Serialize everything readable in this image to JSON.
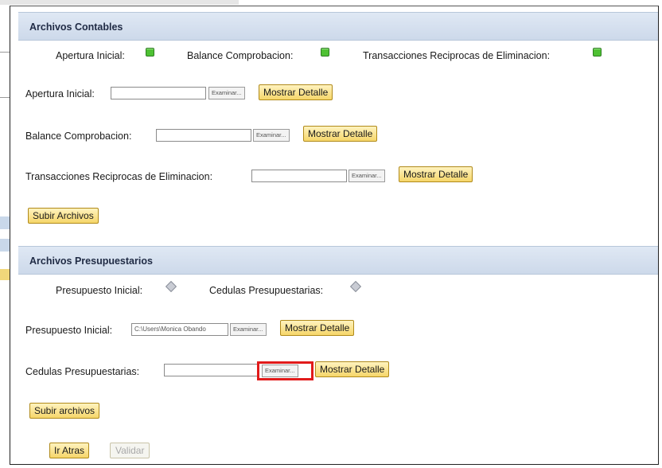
{
  "contables": {
    "title": "Archivos Contables",
    "status": [
      {
        "label": "Apertura Inicial:",
        "state": "green"
      },
      {
        "label": "Balance Comprobacion:",
        "state": "green"
      },
      {
        "label": "Transacciones Reciprocas de Eliminacion:",
        "state": "green"
      }
    ],
    "rows": [
      {
        "label": "Apertura Inicial:",
        "value": "",
        "browse": "Examinar...",
        "detail": "Mostrar Detalle"
      },
      {
        "label": "Balance Comprobacion:",
        "value": "",
        "browse": "Examinar...",
        "detail": "Mostrar Detalle"
      },
      {
        "label": "Transacciones Reciprocas de Eliminacion:",
        "value": "",
        "browse": "Examinar...",
        "detail": "Mostrar Detalle"
      }
    ],
    "upload_label": "Subir Archivos"
  },
  "presupuestarios": {
    "title": "Archivos Presupuestarios",
    "status": [
      {
        "label": "Presupuesto Inicial:",
        "state": "gray"
      },
      {
        "label": "Cedulas Presupuestarias:",
        "state": "gray"
      }
    ],
    "rows": [
      {
        "label": "Presupuesto Inicial:",
        "value": "C:\\Users\\Monica Obando",
        "browse": "Examinar...",
        "detail": "Mostrar Detalle"
      },
      {
        "label": "Cedulas Presupuestarias:",
        "value": "",
        "browse": "Examinar...",
        "detail": "Mostrar Detalle"
      }
    ],
    "upload_label": "Subir archivos"
  },
  "footer": {
    "back_label": "Ir Atras",
    "validate_label": "Validar"
  },
  "colors": {
    "status_green": "#4ec133",
    "status_gray": "#c9ccd4",
    "highlight": "#e11b1b",
    "button_yellow": "#f6d66a"
  }
}
